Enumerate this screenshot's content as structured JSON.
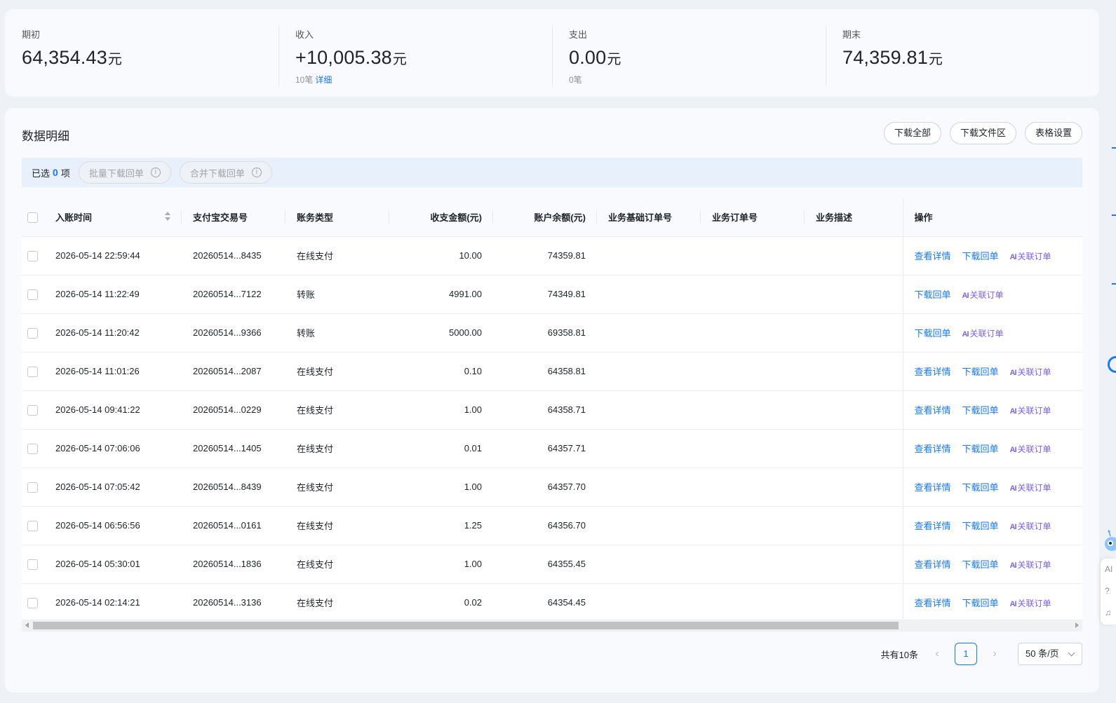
{
  "summary": {
    "opening": {
      "label": "期初",
      "value": "64,354.43",
      "unit": "元",
      "sub": "",
      "link": ""
    },
    "income": {
      "label": "收入",
      "value": "+10,005.38",
      "unit": "元",
      "sub": "10笔",
      "link": "详细"
    },
    "expense": {
      "label": "支出",
      "value": "0.00",
      "unit": "元",
      "sub": "0笔",
      "link": ""
    },
    "closing": {
      "label": "期末",
      "value": "74,359.81",
      "unit": "元",
      "sub": "",
      "link": ""
    }
  },
  "detail": {
    "title": "数据明细",
    "buttons": {
      "download_all": "下载全部",
      "download_files": "下载文件区",
      "table_settings": "表格设置"
    }
  },
  "selection": {
    "prefix": "已选",
    "count": "0",
    "suffix": "项",
    "batch_download": "批量下载回单",
    "merge_download": "合并下载回单",
    "info_glyph": "i"
  },
  "table": {
    "headers": {
      "time": "入账时间",
      "trade_no": "支付宝交易号",
      "type": "账务类型",
      "amount": "收支金额(元)",
      "balance": "账户余额(元)",
      "base_order": "业务基础订单号",
      "order": "业务订单号",
      "desc": "业务描述",
      "ops": "操作"
    },
    "op_labels": {
      "view": "查看详情",
      "download": "下载回单",
      "ai_mark": "AI",
      "link_order": "关联订单"
    },
    "rows": [
      {
        "time": "2026-05-14 22:59:44",
        "trade_no": "20260514...8435",
        "type": "在线支付",
        "amount": "10.00",
        "balance": "74359.81",
        "has_view": true
      },
      {
        "time": "2026-05-14 11:22:49",
        "trade_no": "20260514...7122",
        "type": "转账",
        "amount": "4991.00",
        "balance": "74349.81",
        "has_view": false
      },
      {
        "time": "2026-05-14 11:20:42",
        "trade_no": "20260514...9366",
        "type": "转账",
        "amount": "5000.00",
        "balance": "69358.81",
        "has_view": false
      },
      {
        "time": "2026-05-14 11:01:26",
        "trade_no": "20260514...2087",
        "type": "在线支付",
        "amount": "0.10",
        "balance": "64358.81",
        "has_view": true
      },
      {
        "time": "2026-05-14 09:41:22",
        "trade_no": "20260514...0229",
        "type": "在线支付",
        "amount": "1.00",
        "balance": "64358.71",
        "has_view": true
      },
      {
        "time": "2026-05-14 07:06:06",
        "trade_no": "20260514...1405",
        "type": "在线支付",
        "amount": "0.01",
        "balance": "64357.71",
        "has_view": true
      },
      {
        "time": "2026-05-14 07:05:42",
        "trade_no": "20260514...8439",
        "type": "在线支付",
        "amount": "1.00",
        "balance": "64357.70",
        "has_view": true
      },
      {
        "time": "2026-05-14 06:56:56",
        "trade_no": "20260514...0161",
        "type": "在线支付",
        "amount": "1.25",
        "balance": "64356.70",
        "has_view": true
      },
      {
        "time": "2026-05-14 05:30:01",
        "trade_no": "20260514...1836",
        "type": "在线支付",
        "amount": "1.00",
        "balance": "64355.45",
        "has_view": true
      },
      {
        "time": "2026-05-14 02:14:21",
        "trade_no": "20260514...3136",
        "type": "在线支付",
        "amount": "0.02",
        "balance": "64354.45",
        "has_view": true
      }
    ]
  },
  "pagination": {
    "total": "共有10条",
    "current": "1",
    "page_size": "50 条/页",
    "prev": "‹",
    "next": "›"
  },
  "side": {
    "ai": "AI",
    "help": "?",
    "service": "♫"
  },
  "colors": {
    "accent": "#1677ff",
    "ai": "#7b61ff",
    "background": "#eef2f7",
    "card": "#f8fafd"
  }
}
